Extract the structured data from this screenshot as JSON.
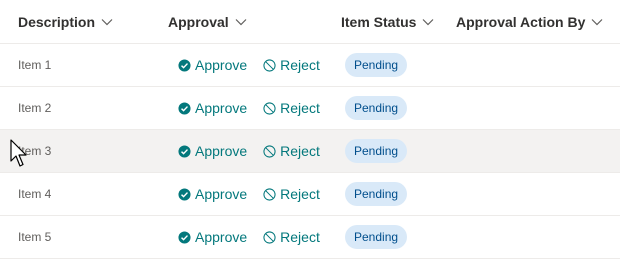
{
  "columns": {
    "description": "Description",
    "approval": "Approval",
    "item_status": "Item Status",
    "approval_action_by": "Approval Action By"
  },
  "actions": {
    "approve": "Approve",
    "reject": "Reject"
  },
  "rows": [
    {
      "description": "Item 1",
      "status": "Pending"
    },
    {
      "description": "Item 2",
      "status": "Pending"
    },
    {
      "description": "Item 3",
      "status": "Pending"
    },
    {
      "description": "Item 4",
      "status": "Pending"
    },
    {
      "description": "Item 5",
      "status": "Pending"
    }
  ],
  "colors": {
    "accent": "#03787c",
    "badge_bg": "#d9e9f8",
    "badge_text": "#004e8c",
    "hover_row": "#f3f2f1"
  },
  "icons": {
    "approve": "check-circle-icon",
    "reject": "blocked-icon",
    "sort": "chevron-down-icon",
    "cursor": "mouse-pointer-icon"
  },
  "hovered_row": 3
}
